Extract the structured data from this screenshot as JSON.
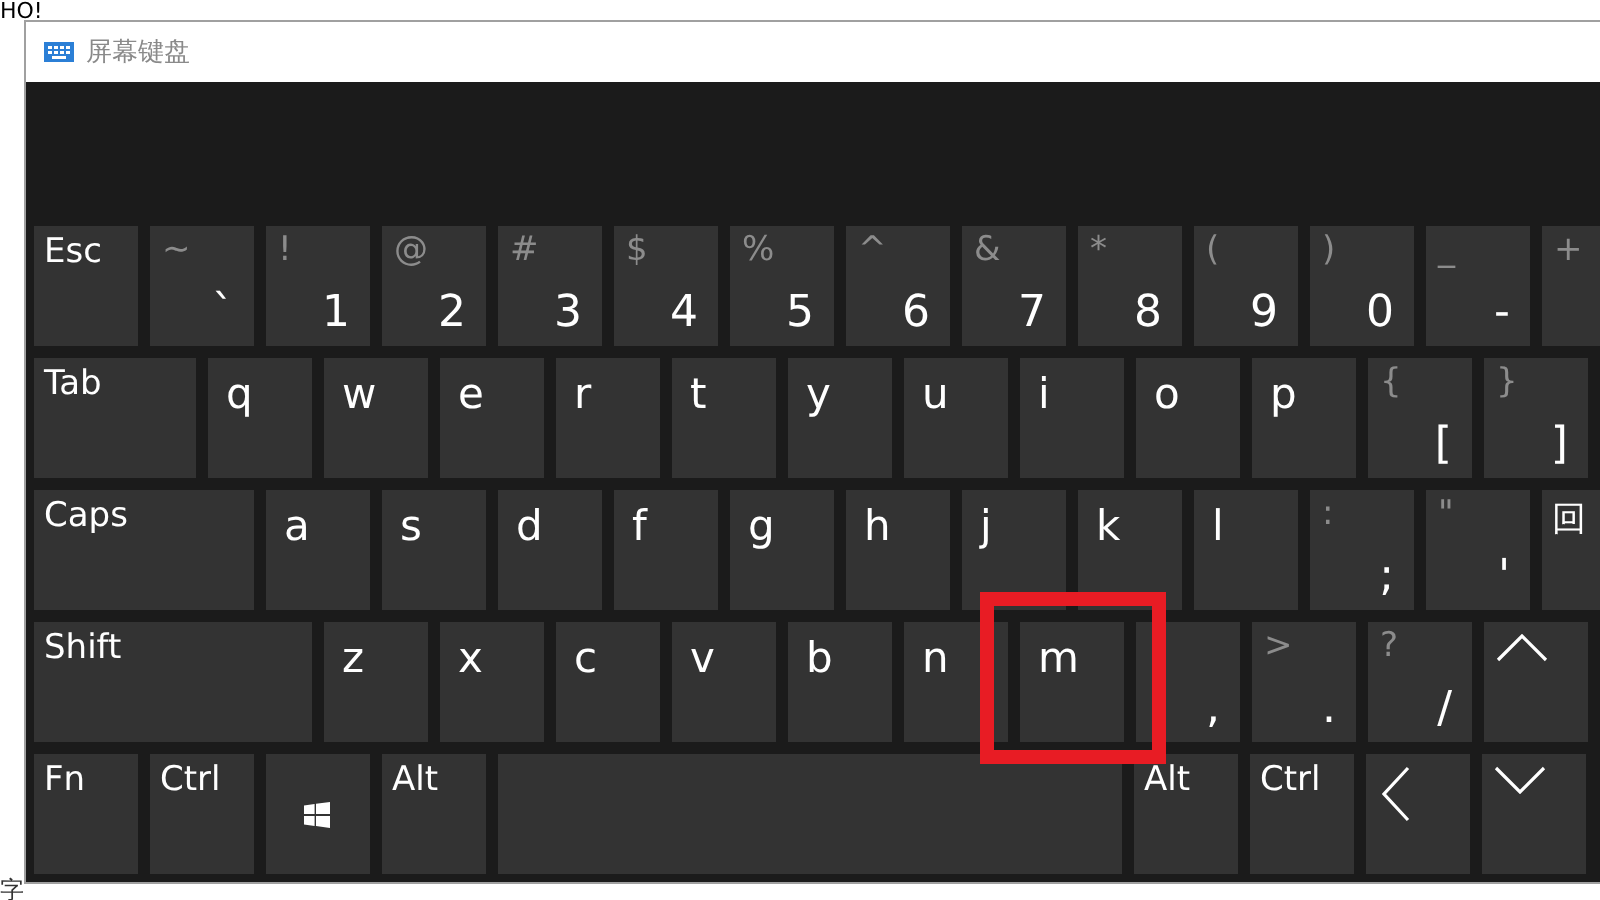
{
  "background": {
    "top_text": "HO!",
    "bottom_text": "字"
  },
  "window": {
    "title": "屏幕键盘"
  },
  "keyboard": {
    "rows": [
      [
        {
          "kind": "word",
          "label": "Esc"
        },
        {
          "kind": "char",
          "shift": "~",
          "main": "`"
        },
        {
          "kind": "char",
          "shift": "!",
          "main": "1"
        },
        {
          "kind": "char",
          "shift": "@",
          "main": "2"
        },
        {
          "kind": "char",
          "shift": "#",
          "main": "3"
        },
        {
          "kind": "char",
          "shift": "$",
          "main": "4"
        },
        {
          "kind": "char",
          "shift": "%",
          "main": "5"
        },
        {
          "kind": "char",
          "shift": "^",
          "main": "6"
        },
        {
          "kind": "char",
          "shift": "&",
          "main": "7"
        },
        {
          "kind": "char",
          "shift": "*",
          "main": "8"
        },
        {
          "kind": "char",
          "shift": "(",
          "main": "9"
        },
        {
          "kind": "char",
          "shift": ")",
          "main": "0"
        },
        {
          "kind": "char",
          "shift": "_",
          "main": "-"
        },
        {
          "kind": "char",
          "shift": "+"
        }
      ],
      [
        {
          "kind": "word",
          "label": "Tab"
        },
        {
          "kind": "letter",
          "label": "q"
        },
        {
          "kind": "letter",
          "label": "w"
        },
        {
          "kind": "letter",
          "label": "e"
        },
        {
          "kind": "letter",
          "label": "r"
        },
        {
          "kind": "letter",
          "label": "t"
        },
        {
          "kind": "letter",
          "label": "y"
        },
        {
          "kind": "letter",
          "label": "u"
        },
        {
          "kind": "letter",
          "label": "i"
        },
        {
          "kind": "letter",
          "label": "o"
        },
        {
          "kind": "letter",
          "label": "p"
        },
        {
          "kind": "char",
          "shift": "{",
          "main": "["
        },
        {
          "kind": "char",
          "shift": "}",
          "main": "]"
        }
      ],
      [
        {
          "kind": "word",
          "label": "Caps"
        },
        {
          "kind": "letter",
          "label": "a"
        },
        {
          "kind": "letter",
          "label": "s"
        },
        {
          "kind": "letter",
          "label": "d"
        },
        {
          "kind": "letter",
          "label": "f"
        },
        {
          "kind": "letter",
          "label": "g"
        },
        {
          "kind": "letter",
          "label": "h"
        },
        {
          "kind": "letter",
          "label": "j"
        },
        {
          "kind": "letter",
          "label": "k"
        },
        {
          "kind": "letter",
          "label": "l"
        },
        {
          "kind": "char",
          "shift": ":",
          "main": ";"
        },
        {
          "kind": "char",
          "shift": "\"",
          "main": "'"
        },
        {
          "kind": "word",
          "label": "回"
        }
      ],
      [
        {
          "kind": "word",
          "label": "Shift"
        },
        {
          "kind": "letter",
          "label": "z"
        },
        {
          "kind": "letter",
          "label": "x"
        },
        {
          "kind": "letter",
          "label": "c"
        },
        {
          "kind": "letter",
          "label": "v"
        },
        {
          "kind": "letter",
          "label": "b"
        },
        {
          "kind": "letter",
          "label": "n"
        },
        {
          "kind": "letter",
          "label": "m"
        },
        {
          "kind": "char",
          "main": ","
        },
        {
          "kind": "char",
          "shift": ">",
          "main": "."
        },
        {
          "kind": "char",
          "shift": "?",
          "main": "/"
        },
        {
          "kind": "up"
        }
      ],
      [
        {
          "kind": "word",
          "label": "Fn"
        },
        {
          "kind": "word",
          "label": "Ctrl"
        },
        {
          "kind": "windows"
        },
        {
          "kind": "word",
          "label": "Alt"
        },
        {
          "kind": "space"
        },
        {
          "kind": "word",
          "label": "Alt"
        },
        {
          "kind": "word",
          "label": "Ctrl"
        },
        {
          "kind": "left"
        },
        {
          "kind": "down"
        }
      ]
    ]
  }
}
